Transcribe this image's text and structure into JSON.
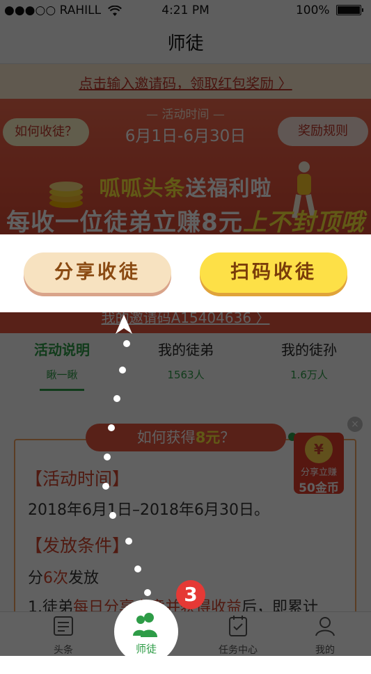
{
  "status_bar": {
    "carrier": "●●●○○ RAHILL",
    "wifi": "wifi-icon",
    "time": "4:21 PM",
    "battery": "100%"
  },
  "nav": {
    "title": "师徒"
  },
  "invite": {
    "text": "点击输入邀请码，领取红包奖励 〉"
  },
  "banner": {
    "time_label": "— 活动时间 —",
    "time_range": "6月1日-6月30日",
    "how_pill": "如何收徒？",
    "rules_pill": "奖励规则",
    "promo_yellow": "呱呱头条",
    "promo_white": "送福利啦",
    "promo_main": "每收一位徒弟立赚8元",
    "promo_tail": "上不封顶哦"
  },
  "share": {
    "share_label": "分享收徒",
    "scan_label": "扫码收徒"
  },
  "code_strip": {
    "text": "我的邀请码A15404636 〉"
  },
  "tabs": [
    {
      "label": "活动说明",
      "sub": "瞅一瞅"
    },
    {
      "label": "我的徒弟",
      "sub": "1563人"
    },
    {
      "label": "我的徒孙",
      "sub": "1.6万人"
    }
  ],
  "content": {
    "how_pill_prefix": "如何获得",
    "how_pill_amount": "8元",
    "how_pill_suffix": "？",
    "sec1_title": "【活动时间】",
    "sec1_body": "2018年6月1日–2018年6月30日。",
    "sec2_title": "【发放条件】",
    "sec2_prefix": "分",
    "sec2_red": "6次",
    "sec2_suffix": "发放",
    "sec2_line": "1.徒弟",
    "sec2_line_red": "每日分享文章并获得收益",
    "sec2_line_end": "后，即累计"
  },
  "coin_badge": {
    "symbol": "¥",
    "line1": "分享立赚",
    "line2": "50金币"
  },
  "close": "×",
  "tab_bar": [
    {
      "label": "头条",
      "icon": "news-icon"
    },
    {
      "label": "师徒",
      "icon": "users-icon"
    },
    {
      "label": "任务中心",
      "icon": "task-icon"
    },
    {
      "label": "我的",
      "icon": "profile-icon"
    }
  ],
  "step": "3",
  "colors": {
    "accent_green": "#2e9c47",
    "accent_red": "#e8573f",
    "yellow": "#fde047"
  }
}
